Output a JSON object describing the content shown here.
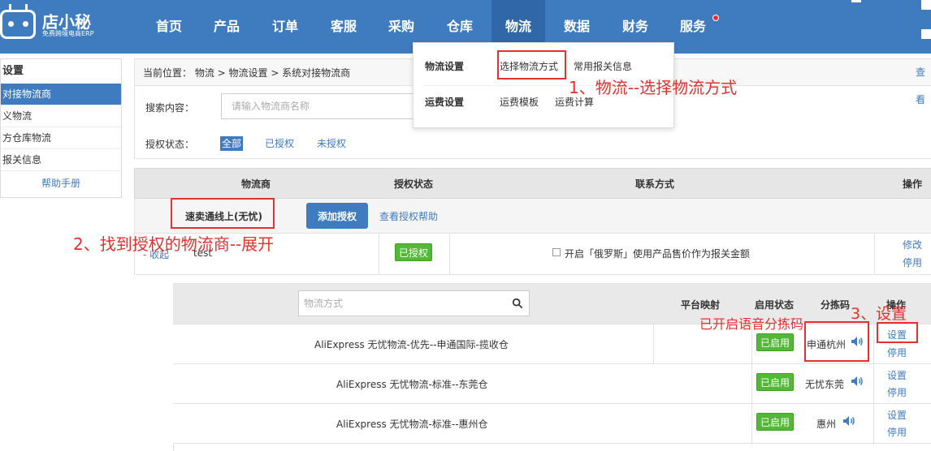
{
  "header": {
    "logo_name": "店小秘",
    "logo_sub": "免费跨境电商ERP",
    "nav": [
      "首页",
      "产品",
      "订单",
      "客服",
      "采购",
      "仓库",
      "物流",
      "数据",
      "财务",
      "服务"
    ],
    "active_nav": "物流",
    "accent": "#3f7bbf"
  },
  "dropdown": {
    "row1_head": "物流设置",
    "row1_items": [
      "选择物流方式",
      "常用报关信息"
    ],
    "row2_head": "运费设置",
    "row2_items": [
      "运费模板",
      "运费计算"
    ]
  },
  "sidebar": {
    "title": "设置",
    "items": [
      "对接物流商",
      "义物流",
      "方仓库物流",
      "报关信息"
    ],
    "help": "帮助手册"
  },
  "breadcrumb": {
    "text": "当前位置： 物流 > 物流设置 > 系统对接物流商",
    "right_link": "查看"
  },
  "search": {
    "label": "搜索内容：",
    "placeholder": "请输入物流商名称",
    "status_label": "授权状态：",
    "filters": [
      "全部",
      "已授权",
      "未授权"
    ]
  },
  "provider_table": {
    "headers": [
      "物流商",
      "授权状态",
      "联系方式",
      "操作"
    ],
    "provider_name": "速卖通线上(无忧)",
    "add_button": "添加授权",
    "help_link": "查看授权帮助",
    "collapse": "- 收起",
    "account": "test",
    "status": "已授权",
    "option_text": "开启「俄罗斯」使用产品售价作为报关金额",
    "ops": [
      "修改",
      "停用"
    ]
  },
  "method_table": {
    "search_placeholder": "物流方式",
    "headers": [
      "平台映射",
      "启用状态",
      "分拣码",
      "操作"
    ],
    "rows": [
      {
        "name": "AliExpress 无忧物流-优先--申通国际-揽收仓",
        "status": "已启用",
        "code": "申通杭州",
        "ops": [
          "设置",
          "停用"
        ]
      },
      {
        "name": "AliExpress 无忧物流-标准--东莞仓",
        "status": "已启用",
        "code": "无忧东莞",
        "ops": [
          "设置",
          "停用"
        ]
      },
      {
        "name": "AliExpress 无忧物流-标准--惠州仓",
        "status": "已启用",
        "code": "惠州",
        "ops": [
          "设置",
          "停用"
        ]
      }
    ]
  },
  "annotations": {
    "step1": "1、物流--选择物流方式",
    "step2": "2、找到授权的物流商--展开",
    "step3": "3、设置",
    "voice_note": "已开启语音分拣码"
  }
}
